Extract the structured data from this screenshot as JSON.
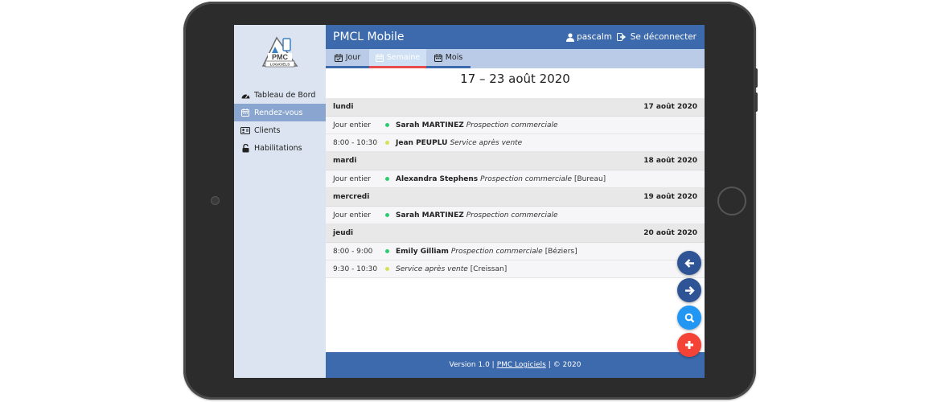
{
  "app": {
    "title": "PMCL Mobile",
    "user": "pascalm",
    "logout_label": "Se déconnecter"
  },
  "logo": {
    "line1": "PMC",
    "line2": "LOGICIELS"
  },
  "sidebar": {
    "items": [
      {
        "label": "Tableau de Bord",
        "icon": "dashboard-icon",
        "active": false
      },
      {
        "label": "Rendez-vous",
        "icon": "calendar-icon",
        "active": true
      },
      {
        "label": "Clients",
        "icon": "id-card-icon",
        "active": false
      },
      {
        "label": "Habilitations",
        "icon": "unlock-icon",
        "active": false
      }
    ]
  },
  "tabs": [
    {
      "label": "Jour",
      "active": false
    },
    {
      "label": "Semaine",
      "active": true
    },
    {
      "label": "Mois",
      "active": false
    }
  ],
  "week_title": "17 – 23 août 2020",
  "days": [
    {
      "name": "lundi",
      "date": "17 août 2020",
      "events": [
        {
          "time": "Jour entier",
          "dot": "#2ecc71",
          "name": "Sarah MARTINEZ",
          "type": "Prospection commerciale",
          "place": ""
        },
        {
          "time": "8:00 - 10:30",
          "dot": "#d4e157",
          "name": "Jean PEUPLU",
          "type": "Service après vente",
          "place": ""
        }
      ]
    },
    {
      "name": "mardi",
      "date": "18 août 2020",
      "events": [
        {
          "time": "Jour entier",
          "dot": "#2ecc71",
          "name": "Alexandra Stephens",
          "type": "Prospection commerciale",
          "place": "[Bureau]"
        }
      ]
    },
    {
      "name": "mercredi",
      "date": "19 août 2020",
      "events": [
        {
          "time": "Jour entier",
          "dot": "#2ecc71",
          "name": "Sarah MARTINEZ",
          "type": "Prospection commerciale",
          "place": ""
        }
      ]
    },
    {
      "name": "jeudi",
      "date": "20 août 2020",
      "events": [
        {
          "time": "8:00 - 9:00",
          "dot": "#2ecc71",
          "name": "Emily Gilliam",
          "type": "Prospection commerciale",
          "place": "[Béziers]"
        },
        {
          "time": "9:30 - 10:30",
          "dot": "#d4e157",
          "name": "",
          "type": "Service après vente",
          "place": "[Creissan]"
        }
      ]
    }
  ],
  "footer": {
    "prefix": "Version 1.0 |",
    "link": "PMC Logiciels",
    "suffix": "| © 2020"
  },
  "fabs": [
    {
      "name": "previous-week-button",
      "icon": "arrow-left-icon",
      "color": "#2f5496"
    },
    {
      "name": "next-week-button",
      "icon": "arrow-right-icon",
      "color": "#2f5496"
    },
    {
      "name": "search-button",
      "icon": "search-icon",
      "color": "#2196f3"
    },
    {
      "name": "add-appointment-button",
      "icon": "plus-icon",
      "color": "#f44336"
    }
  ],
  "colors": {
    "header": "#3d6aad",
    "sidebar": "#dbe4f0",
    "tabs": "#b9cbe6",
    "active_tab_indicator": "#e84c4c"
  }
}
